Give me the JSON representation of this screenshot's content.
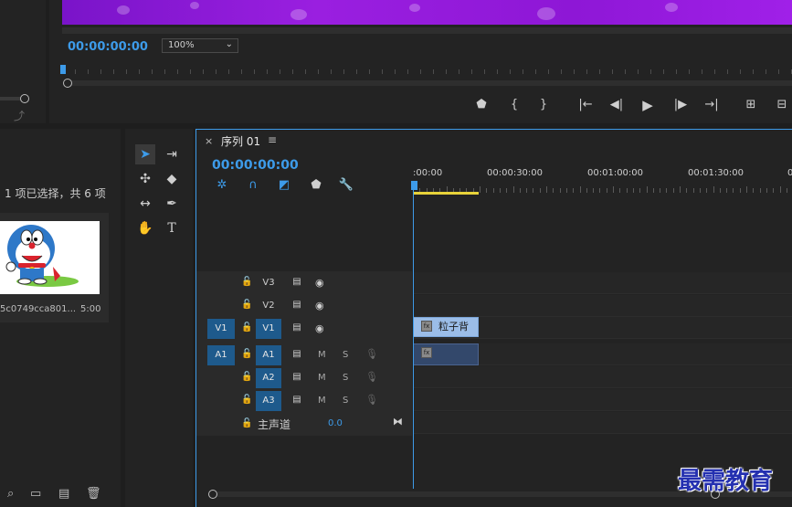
{
  "monitor": {
    "timecode": "00:00:00:00",
    "zoom": "100%",
    "controls": {
      "marker": "⬟",
      "mark_in": "{",
      "mark_out": "}",
      "go_in": "|←",
      "step_back": "◀|",
      "play": "▶",
      "step_forward": "|▶",
      "go_out": "→|",
      "lift": "⊞",
      "extract": "⊟"
    }
  },
  "project": {
    "status": "1 项已选择，共 6 项",
    "clip_name": "5c0749cca801...",
    "clip_duration": "5:00"
  },
  "timeline": {
    "tab_close": "×",
    "tab_name": "序列 01",
    "tab_menu": "≡",
    "timecode": "00:00:00:00",
    "ruler_labels": [
      ":00:00",
      "00:00:30:00",
      "00:01:00:00",
      "00:01:30:00",
      "0"
    ],
    "tracks_video": [
      {
        "name": "V3",
        "src": "",
        "on": false
      },
      {
        "name": "V2",
        "src": "",
        "on": false
      },
      {
        "name": "V1",
        "src": "V1",
        "on": true
      }
    ],
    "tracks_audio": [
      {
        "name": "A1",
        "src": "A1",
        "m": "M",
        "s": "S"
      },
      {
        "name": "A2",
        "src": "",
        "m": "M",
        "s": "S"
      },
      {
        "name": "A3",
        "src": "",
        "m": "M",
        "s": "S"
      }
    ],
    "master": {
      "label": "主声道",
      "value": "0.0"
    },
    "video_clip": {
      "label": "粒子背",
      "fx": "fx"
    },
    "audio_clip": {
      "fx": "fx"
    }
  },
  "watermark": "最需教育",
  "colors": {
    "accent": "#3d9be9",
    "video_clip": "#9bbde8",
    "audio_clip": "#33486b",
    "track_on": "#1e5a8c",
    "work_area": "#e8d33a",
    "preview": "#8e17d6"
  }
}
